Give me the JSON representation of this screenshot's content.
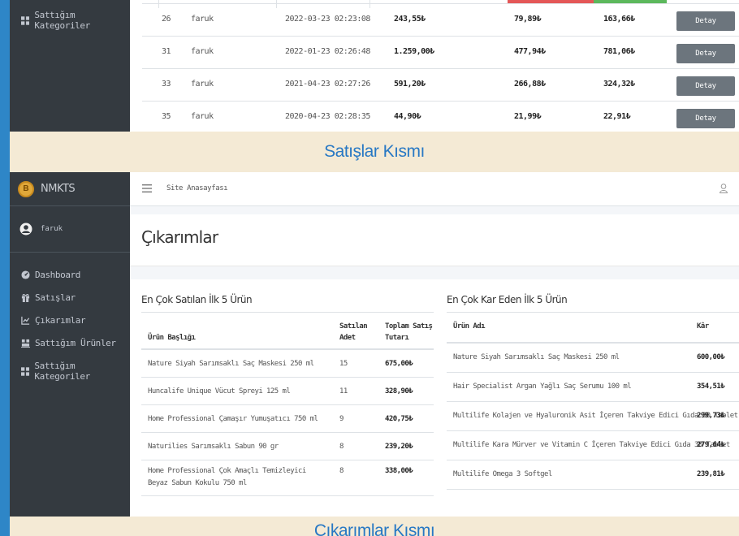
{
  "top_panel": {
    "sidebar_item": "Sattığım Kategoriler",
    "rows": [
      {
        "id": "26",
        "user": "faruk",
        "date": "2022-03-23 02:23:08",
        "total": "243,55₺",
        "cost": "79,89₺",
        "profit": "163,66₺",
        "action": "Detay"
      },
      {
        "id": "31",
        "user": "faruk",
        "date": "2022-01-23 02:26:48",
        "total": "1.259,00₺",
        "cost": "477,94₺",
        "profit": "781,06₺",
        "action": "Detay"
      },
      {
        "id": "33",
        "user": "faruk",
        "date": "2021-04-23 02:27:26",
        "total": "591,20₺",
        "cost": "266,88₺",
        "profit": "324,32₺",
        "action": "Detay"
      },
      {
        "id": "35",
        "user": "faruk",
        "date": "2020-04-23 02:28:35",
        "total": "44,90₺",
        "cost": "21,99₺",
        "profit": "22,91₺",
        "action": "Detay"
      }
    ],
    "colors": {
      "cost_bar": "#e45757",
      "profit_bar": "#5cb85c"
    }
  },
  "captions": {
    "sales": "Satışlar Kısmı",
    "deductions": "Çıkarımlar Kısmı"
  },
  "bottom_panel": {
    "brand": {
      "logo_letter": "B",
      "name": "NMKTS"
    },
    "user": {
      "name": "faruk"
    },
    "nav": [
      {
        "label": "Dashboard",
        "icon": "tachometer-icon"
      },
      {
        "label": "Satışlar",
        "icon": "gift-icon"
      },
      {
        "label": "Çıkarımlar",
        "icon": "chart-line-icon"
      },
      {
        "label": "Sattığım Ürünler",
        "icon": "warehouse-icon"
      },
      {
        "label": "Sattığım Kategoriler",
        "icon": "grid-icon"
      }
    ],
    "topbar": {
      "home_link": "Site Anasayfası"
    },
    "page_title": "Çıkarımlar",
    "top_sellers": {
      "title": "En Çok Satılan İlk 5 Ürün",
      "headers": {
        "name": "Ürün Başlığı",
        "qty_line1": "Satılan",
        "qty_line2": "Adet",
        "total_line1": "Toplam Satış",
        "total_line2": "Tutarı"
      },
      "rows": [
        {
          "name": "Nature Siyah Sarımsaklı Saç Maskesi 250 ml",
          "qty": "15",
          "total": "675,00₺"
        },
        {
          "name": "Huncalife Unique Vücut Spreyi 125 ml",
          "qty": "11",
          "total": "328,90₺"
        },
        {
          "name": "Home Professional Çamaşır Yumuşatıcı 750 ml",
          "qty": "9",
          "total": "420,75₺"
        },
        {
          "name": "Naturilies Sarımsaklı Sabun 90 gr",
          "qty": "8",
          "total": "239,20₺"
        },
        {
          "name": "Home Professional Çok Amaçlı Temizleyici Beyaz Sabun Kokulu 750 ml",
          "qty": "8",
          "total": "338,00₺"
        }
      ]
    },
    "top_profit": {
      "title": "En Çok Kar Eden İlk 5 Ürün",
      "headers": {
        "name": "Ürün Adı",
        "profit": "Kâr"
      },
      "rows": [
        {
          "name": "Nature Siyah Sarımsaklı Saç Maskesi 250 ml",
          "profit": "600,00₺"
        },
        {
          "name": "Hair Specialist Argan Yağlı Saç Serumu 100 ml",
          "profit": "354,51₺"
        },
        {
          "name": "Multilife Kolajen ve Hyaluronik Asit İçeren Takviye Edici Gıda 30 Tablet",
          "profit": "299,73₺"
        },
        {
          "name": "Multilife Kara Mürver ve Vitamin C İçeren Takviye Edici Gıda 30 Tablet",
          "profit": "279,64₺"
        },
        {
          "name": "Multilife Omega 3 Softgel",
          "profit": "239,81₺"
        }
      ]
    }
  }
}
